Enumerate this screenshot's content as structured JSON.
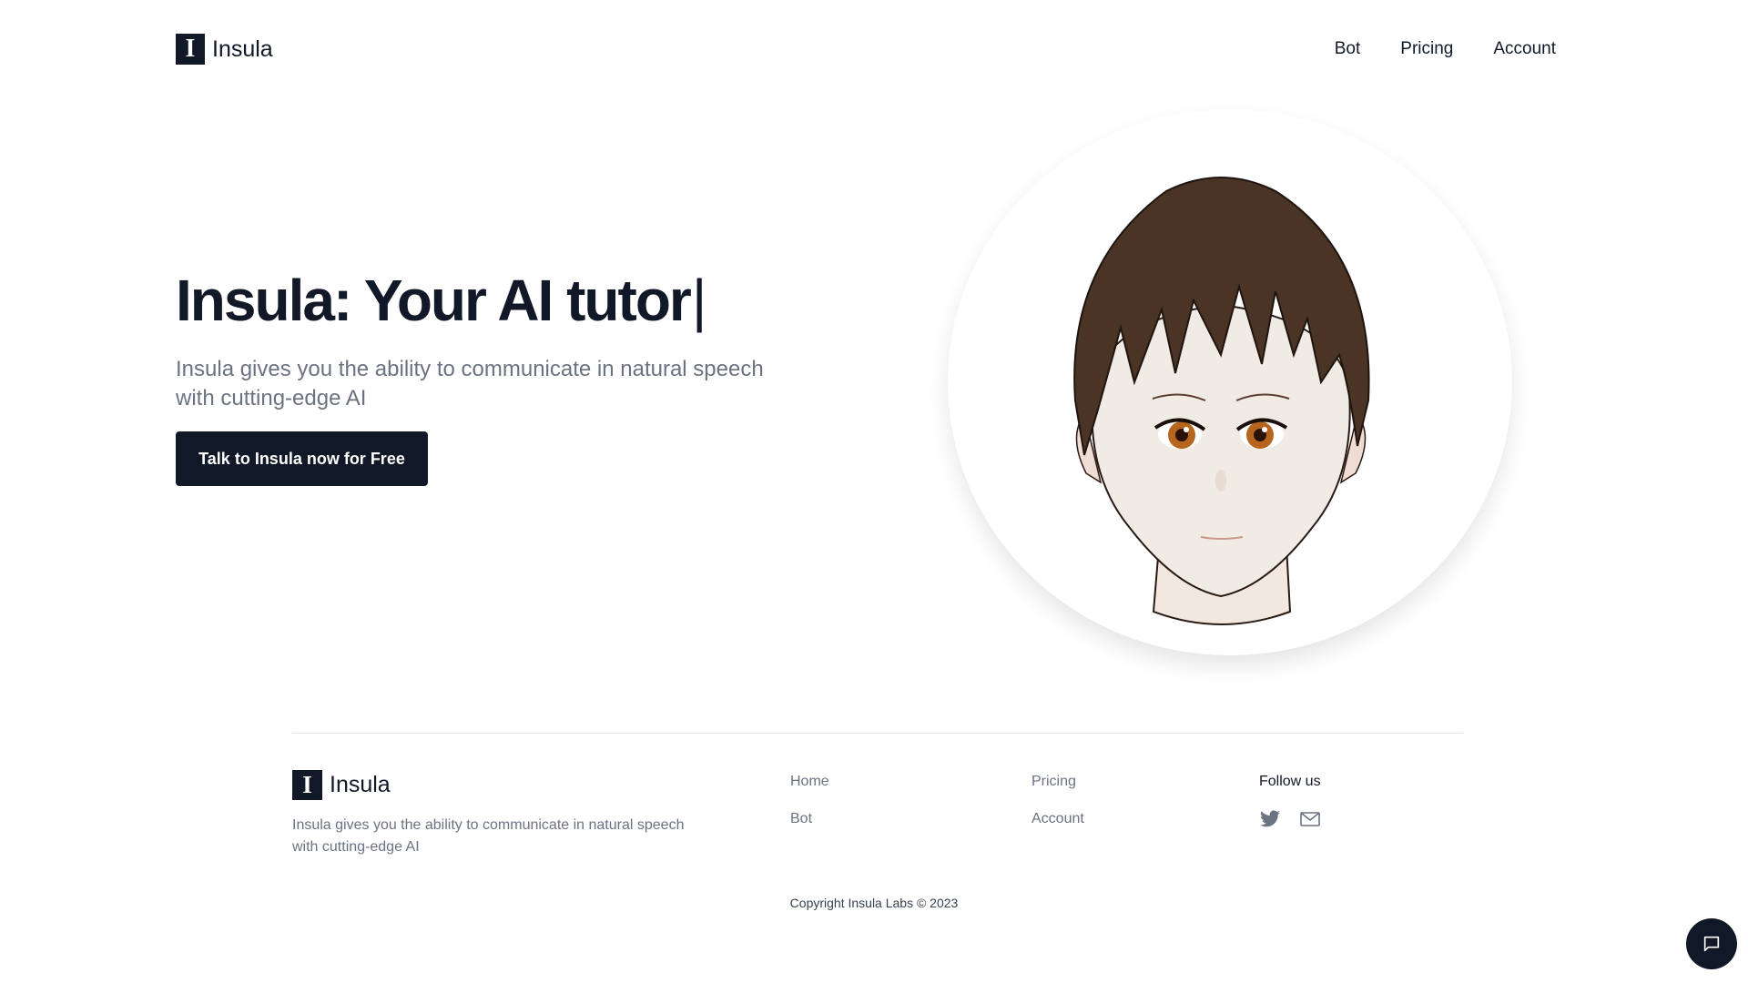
{
  "header": {
    "logo_glyph": "I",
    "brand": "Insula",
    "nav": [
      {
        "label": "Bot"
      },
      {
        "label": "Pricing"
      },
      {
        "label": "Account"
      }
    ]
  },
  "hero": {
    "title": "Insula: Your AI tutor",
    "cursor": "|",
    "subtitle": "Insula gives you the ability to communicate in natural speech with cutting-edge AI",
    "cta_label": "Talk to Insula now for Free"
  },
  "footer": {
    "logo_glyph": "I",
    "brand": "Insula",
    "description": "Insula gives you the ability to communicate in natural speech with cutting-edge AI",
    "col1": [
      {
        "label": "Home"
      },
      {
        "label": "Bot"
      }
    ],
    "col2": [
      {
        "label": "Pricing"
      },
      {
        "label": "Account"
      }
    ],
    "follow_title": "Follow us",
    "social_icons": [
      "twitter-icon",
      "mail-icon"
    ],
    "copyright": "Copyright Insula Labs © 2023"
  },
  "chat_widget": {
    "icon": "chat-bubble-icon"
  },
  "colors": {
    "primary": "#111827",
    "muted_text": "#6b7280",
    "hair": "#4a3426",
    "skin": "#f1ebe6",
    "eye": "#b5651d"
  }
}
